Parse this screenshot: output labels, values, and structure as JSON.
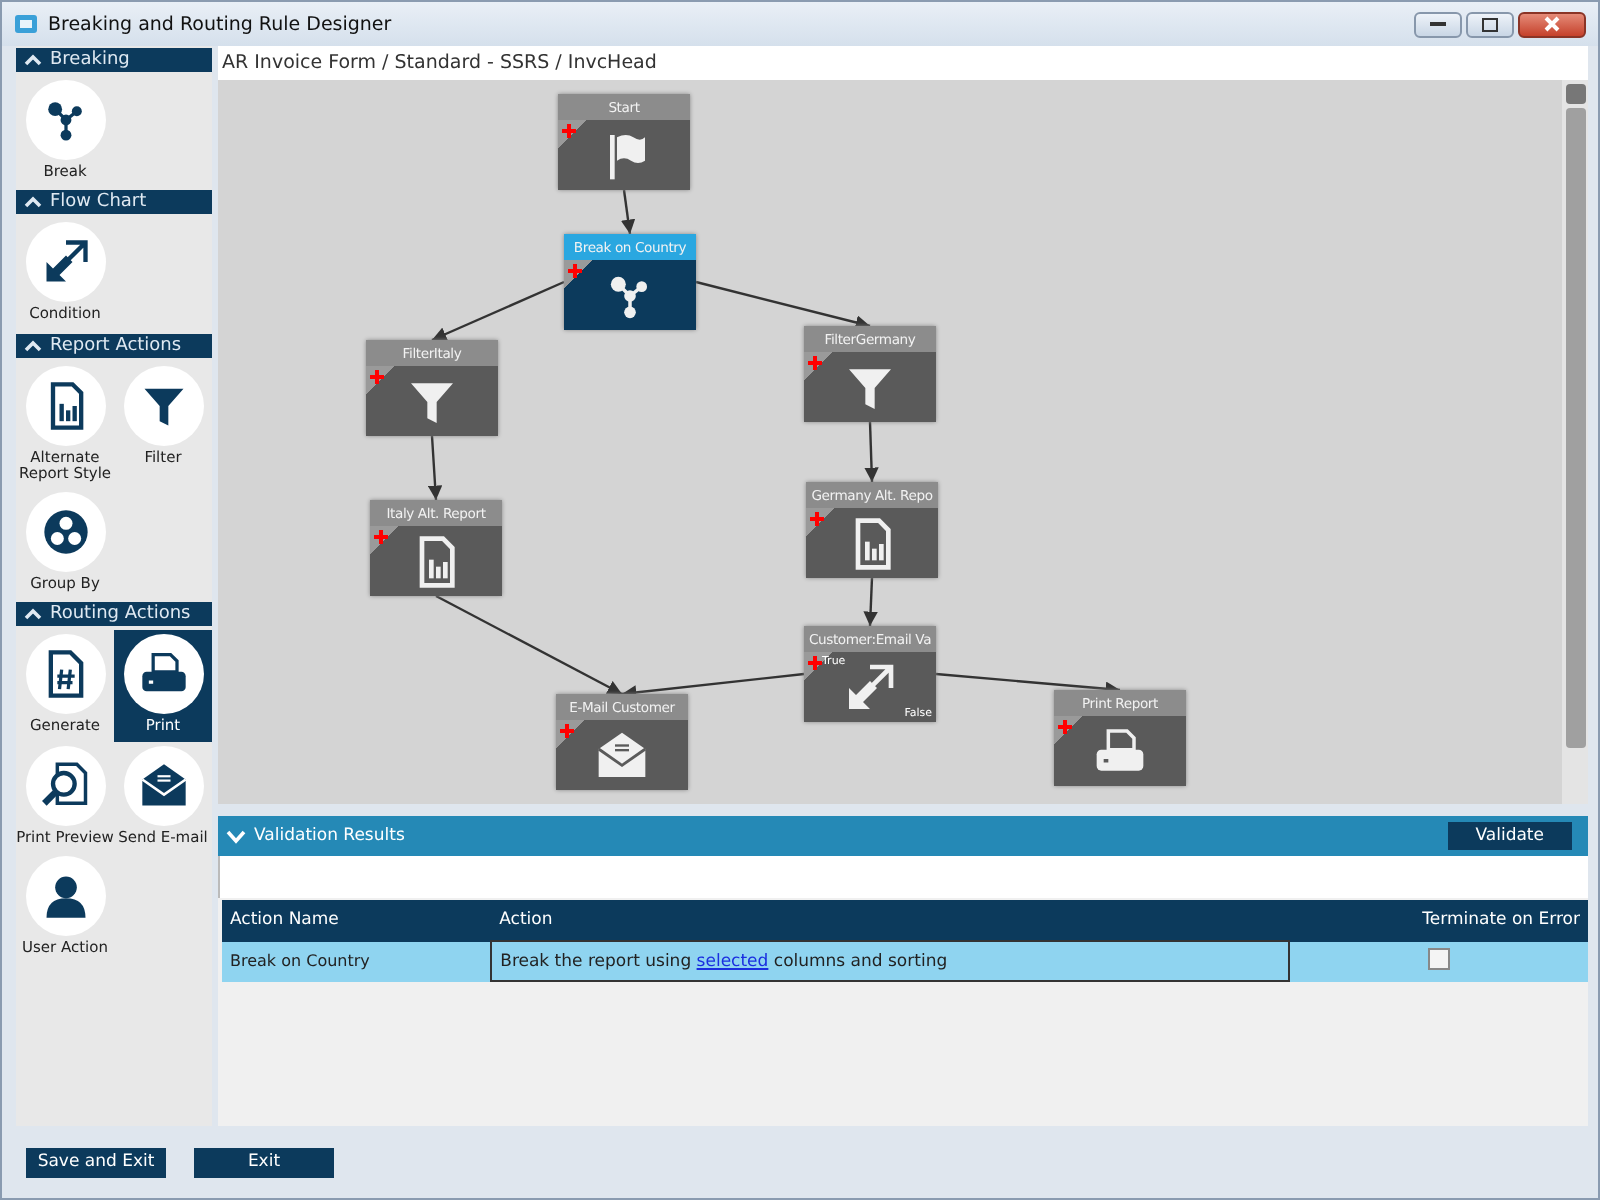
{
  "window": {
    "title": "Breaking and Routing Rule Designer"
  },
  "sidebar": {
    "sections": [
      {
        "title": "Breaking",
        "items": [
          {
            "label": "Break",
            "kind": "break",
            "selected": false
          }
        ]
      },
      {
        "title": "Flow Chart",
        "items": [
          {
            "label": "Condition",
            "kind": "condition",
            "selected": false
          }
        ]
      },
      {
        "title": "Report Actions",
        "items": [
          {
            "label": "Alternate Report Style",
            "kind": "report",
            "selected": false
          },
          {
            "label": "Filter",
            "kind": "filter",
            "selected": false
          },
          {
            "label": "Group By",
            "kind": "group",
            "selected": false
          }
        ]
      },
      {
        "title": "Routing Actions",
        "items": [
          {
            "label": "Generate",
            "kind": "generate",
            "selected": false
          },
          {
            "label": "Print",
            "kind": "print",
            "selected": true
          },
          {
            "label": "Print Preview",
            "kind": "preview",
            "selected": false
          },
          {
            "label": "Send E-mail",
            "kind": "email",
            "selected": false
          },
          {
            "label": "User Action",
            "kind": "user",
            "selected": false
          }
        ]
      }
    ]
  },
  "breadcrumb": "AR Invoice Form / Standard - SSRS / InvcHead",
  "diagram": {
    "nodes": [
      {
        "title": "Start",
        "kind": "start",
        "selected": false
      },
      {
        "title": "Break on Country",
        "kind": "break",
        "selected": true
      },
      {
        "title": "FilterItaly",
        "kind": "filter",
        "selected": false
      },
      {
        "title": "FilterGermany",
        "kind": "filter",
        "selected": false
      },
      {
        "title": "Italy Alt. Report",
        "kind": "report",
        "selected": false
      },
      {
        "title": "Germany Alt. Repo",
        "kind": "report",
        "selected": false
      },
      {
        "title": "E-Mail  Customer",
        "kind": "email",
        "selected": false
      },
      {
        "title": "Customer:Email Va",
        "kind": "condition",
        "selected": false,
        "true_label": "True",
        "false_label": "False"
      },
      {
        "title": "Print Report",
        "kind": "print",
        "selected": false
      }
    ]
  },
  "validation": {
    "title": "Validation Results",
    "expanded": true,
    "button": "Validate"
  },
  "table": {
    "columns": [
      "Action Name",
      "Action",
      "Terminate on Error"
    ],
    "rows": [
      {
        "name": "Break on Country",
        "action_before": "Break the report using ",
        "action_link": "selected",
        "action_after": " columns and sorting",
        "checked": false
      }
    ]
  },
  "buttons": [
    "Save and Exit",
    "Exit"
  ]
}
